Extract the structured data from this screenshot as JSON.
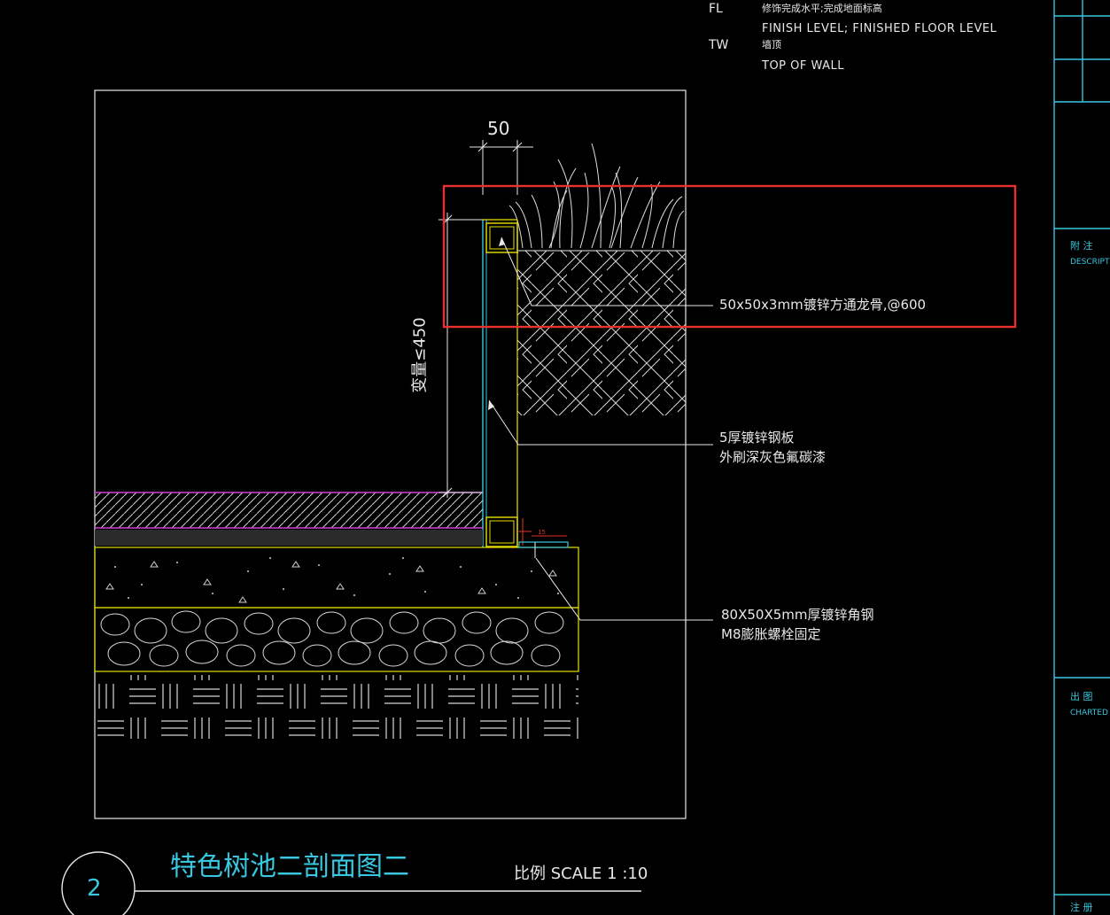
{
  "legend": [
    {
      "code": "FL",
      "cn": "修饰完成水平;完成地面标高",
      "en": "FINISH LEVEL; FINISHED FLOOR LEVEL"
    },
    {
      "code": "TW",
      "cn": "墙顶",
      "en": "TOP OF WALL"
    }
  ],
  "dimensions": {
    "top": "50",
    "vertical": "变量≤450",
    "small_red": "15"
  },
  "callouts": {
    "steel_tube": "50x50x3mm镀锌方通龙骨,@600",
    "steel_plate_line1": "5厚镀锌钢板",
    "steel_plate_line2": "外刷深灰色氟碳漆",
    "angle_line1": "80X50X5mm厚镀锌角钢",
    "angle_line2": "M8膨胀螺栓固定"
  },
  "title": {
    "number": "2",
    "name": "特色树池二剖面图二",
    "scale": "比例 SCALE 1 :10"
  },
  "title_block": {
    "desc_cn": "附 注",
    "desc_en": "DESCRIPTION",
    "chart_cn": "出 图",
    "chart_en": "CHARTED",
    "bottom_cn": "注 册"
  },
  "colors": {
    "background": "#000000",
    "lines": "#e8e8e8",
    "cyan": "#39c6e0",
    "yellow": "#e8e000",
    "magenta": "#d040d0",
    "highlight": "#e8302c"
  }
}
